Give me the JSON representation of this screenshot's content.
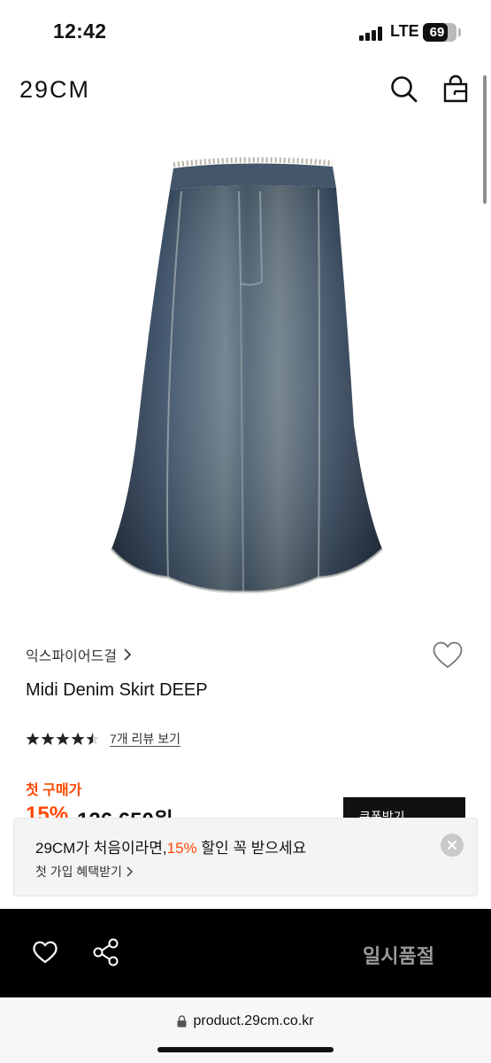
{
  "status_bar": {
    "time": "12:42",
    "network": "LTE",
    "battery": "69"
  },
  "header": {
    "logo": "29CM",
    "icons": [
      "search-icon",
      "bag-icon"
    ]
  },
  "product": {
    "brand": "익스파이어드걸",
    "name": "Midi Denim Skirt DEEP",
    "rating": 4.5,
    "review_link": "7개 리뷰 보기",
    "first_price_label": "첫 구매가",
    "discount": "15%",
    "price": "126,650원",
    "coupon_button": "쿠폰받기"
  },
  "banner": {
    "title_prefix": "29CM가 처음이라면,",
    "title_highlight": "15%",
    "title_suffix": " 할인 꼭 받으세요",
    "subtitle": "첫 가입 혜택받기"
  },
  "bottom_bar": {
    "sold_out": "일시품절",
    "icons": [
      "heart-icon",
      "share-icon"
    ]
  },
  "browser": {
    "url": "product.29cm.co.kr"
  },
  "colors": {
    "accent": "#ff4800",
    "bar": "#000000",
    "banner_bg": "#f4f4f4"
  }
}
